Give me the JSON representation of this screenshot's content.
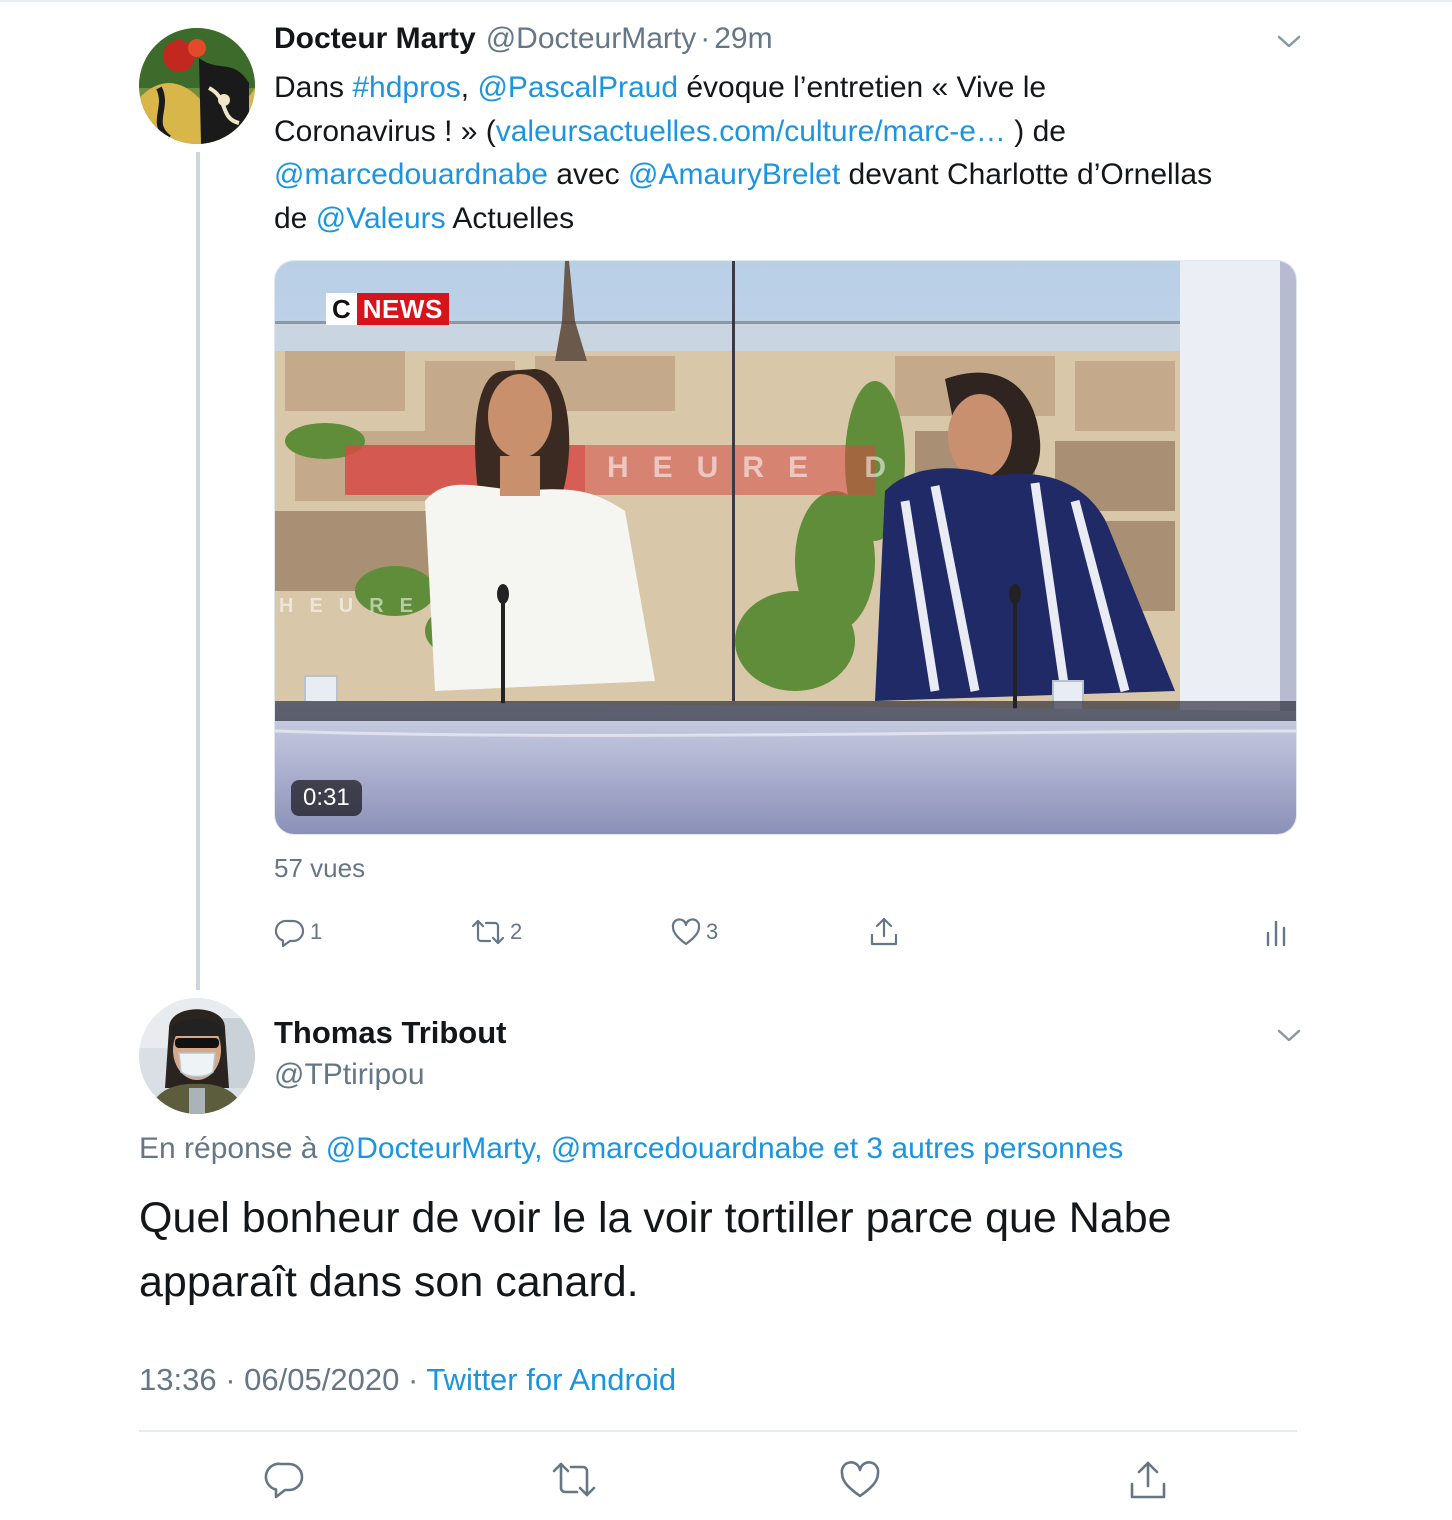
{
  "tweet1": {
    "author_name": "Docteur Marty",
    "author_handle": "@DocteurMarty",
    "separator": "·",
    "time_ago": "29m",
    "text": {
      "l1_a": "Dans ",
      "l1_hashtag": "#hdpros",
      "l1_b": ", ",
      "l1_mention": "@PascalPraud",
      "l1_c": " évoque l’entretien « Vive le",
      "l2_a": "Coronavirus ! » (",
      "l2_link": "valeursactuelles.com/culture/marc-e…",
      "l2_b": " ) de",
      "l3_mention1": "@marcedouardnabe",
      "l3_a": " avec ",
      "l3_mention2": "@AmauryBrelet",
      "l3_b": " devant Charlotte d’Ornellas",
      "l4_a": "de ",
      "l4_mention": "@Valeurs",
      "l4_b": " Actuelles"
    },
    "media": {
      "logo_c": "C",
      "logo_news": "NEWS",
      "backdrop_text_1": "HEURE D",
      "backdrop_text_2": "HEURE",
      "duration": "0:31"
    },
    "views": "57 vues",
    "actions": {
      "reply_count": "1",
      "retweet_count": "2",
      "like_count": "3"
    }
  },
  "tweet2": {
    "author_name": "Thomas Tribout",
    "author_handle": "@TPtiripou",
    "reply_prefix": "En réponse à ",
    "reply_targets": "@DocteurMarty, @marcedouardnabe et 3 autres personnes",
    "text_line1": "Quel bonheur de voir le la voir tortiller parce que Nabe",
    "text_line2": "apparaît dans son canard.",
    "time": "13:36",
    "date": "06/05/2020",
    "separator": "·",
    "source": "Twitter for Android"
  },
  "colors": {
    "link": "#1b95e0",
    "secondary_text": "#657786",
    "primary_text": "#14171a",
    "divider": "#e6ecf0",
    "cnews_red": "#d7141b"
  },
  "icons": [
    "chevron-down-icon",
    "reply-icon",
    "retweet-icon",
    "like-icon",
    "share-icon",
    "analytics-icon"
  ]
}
